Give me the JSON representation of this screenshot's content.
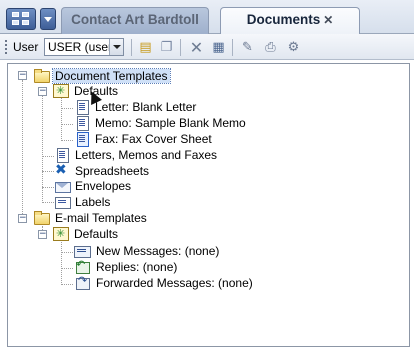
{
  "tabs": {
    "contact_label": "Contact Art Bardtoll",
    "documents_label": "Documents",
    "close_glyph": "✕"
  },
  "toolbar": {
    "user_label": "User",
    "user_value": "USER (user)",
    "icons": [
      "new-folder-icon",
      "copy-icon",
      "delete-icon",
      "properties-icon",
      "edit-icon",
      "print-icon",
      "settings-icon"
    ]
  },
  "tree": {
    "document_templates": "Document Templates",
    "defaults_1": "Defaults",
    "letter_blank": "Letter: Blank Letter",
    "memo_sample": "Memo: Sample Blank Memo",
    "fax_cover": "Fax: Fax Cover Sheet",
    "letters_memos_faxes": "Letters, Memos and Faxes",
    "spreadsheets": "Spreadsheets",
    "envelopes": "Envelopes",
    "labels": "Labels",
    "email_templates": "E-mail Templates",
    "defaults_2": "Defaults",
    "new_messages": "New Messages: (none)",
    "replies": "Replies: (none)",
    "forwarded_messages": "Forwarded Messages: (none)"
  },
  "colors": {
    "selection": "#cfe0f7",
    "tab_active": "#eef2f8",
    "tab_inactive": "#9fb0cc"
  }
}
